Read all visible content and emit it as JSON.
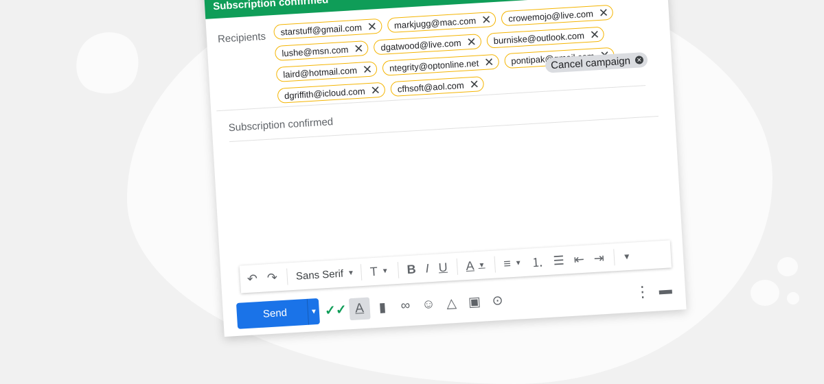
{
  "header": {
    "title": "Subscription confirmed"
  },
  "recipients": {
    "label": "Recipients",
    "rows": [
      [
        "starstuff@gmail.com",
        "markjugg@mac.com",
        "crowemojo@live.com"
      ],
      [
        "lushe@msn.com",
        "dgatwood@live.com",
        "burniske@outlook.com"
      ],
      [
        "laird@hotmail.com",
        "ntegrity@optonline.net",
        "pontipak@gmail.com"
      ],
      [
        "dgriffith@icloud.com",
        "cfhsoft@aol.com"
      ]
    ],
    "cancel_label": "Cancel campaign"
  },
  "subject": "Subscription confirmed",
  "toolbar": {
    "font": "Sans Serif",
    "icons": [
      "undo-icon",
      "redo-icon",
      "font-family-select",
      "text-size-icon",
      "bold-icon",
      "italic-icon",
      "underline-icon",
      "text-color-icon",
      "align-icon",
      "numbered-list-icon",
      "bulleted-list-icon",
      "indent-less-icon",
      "indent-more-icon",
      "more-formatting-icon"
    ]
  },
  "bottom": {
    "send_label": "Send",
    "icons": [
      "double-check-icon",
      "formatting-options-icon",
      "attach-file-icon",
      "insert-link-icon",
      "emoji-icon",
      "drive-icon",
      "photo-icon",
      "confidential-mode-icon",
      "more-options-icon",
      "discard-icon"
    ]
  },
  "colors": {
    "header": "#0f9d58",
    "chip_border": "#f4b400",
    "send": "#1a73e8"
  }
}
